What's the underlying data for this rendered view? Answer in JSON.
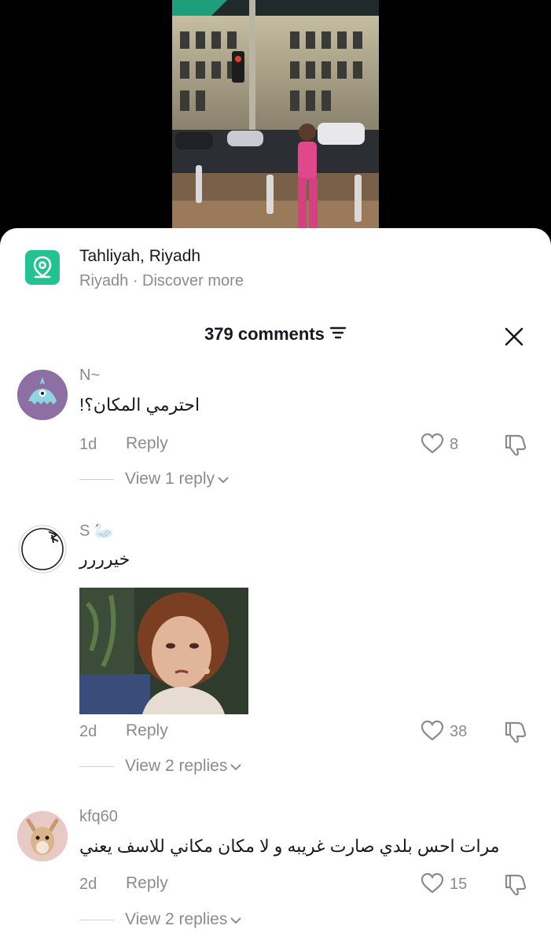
{
  "location": {
    "title": "Tahliyah, Riyadh",
    "subtitle": "Riyadh · Discover more",
    "icon": "map-pin-icon",
    "icon_color": "#22c391"
  },
  "comments_header": {
    "count_label": "379 comments",
    "sort_icon": "sort-icon",
    "close_icon": "close-icon"
  },
  "comments": [
    {
      "username": "N~",
      "text": "احترمي المكان؟!",
      "time": "1d",
      "reply_label": "Reply",
      "likes": "8",
      "view_replies": "View 1 reply"
    },
    {
      "username": "S 🦢",
      "text": "خيرررر",
      "time": "2d",
      "reply_label": "Reply",
      "likes": "38",
      "view_replies": "View 2 replies",
      "has_gif": true
    },
    {
      "username": "kfq60",
      "text": "مرات احس بلدي صارت غريبه و لا مكان مكاني للاسف يعني",
      "time": "2d",
      "reply_label": "Reply",
      "likes": "15",
      "view_replies": "View 2 replies"
    }
  ]
}
